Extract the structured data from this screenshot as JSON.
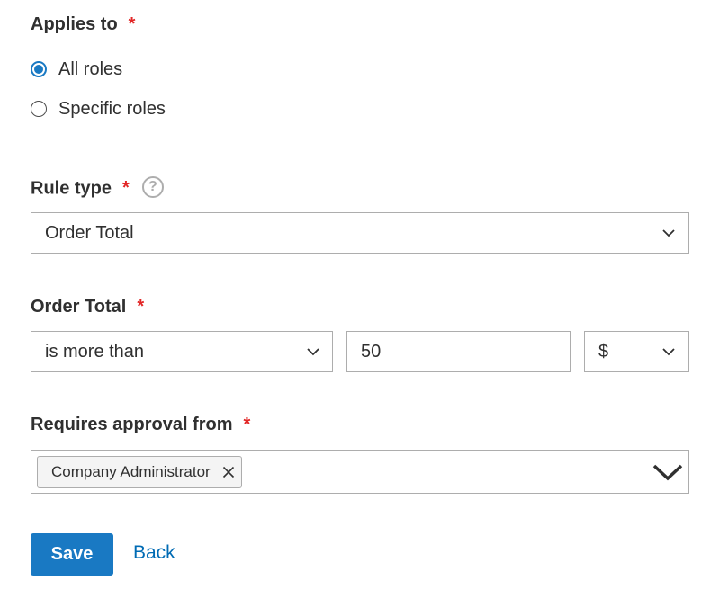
{
  "applies_to": {
    "label": "Applies to",
    "required_mark": "*",
    "options": [
      {
        "label": "All roles",
        "checked": true
      },
      {
        "label": "Specific roles",
        "checked": false
      }
    ]
  },
  "rule_type": {
    "label": "Rule type",
    "required_mark": "*",
    "help_icon": "question-circle-icon",
    "help_glyph": "?",
    "selected": "Order Total"
  },
  "order_total": {
    "label": "Order Total",
    "required_mark": "*",
    "condition": "is more than",
    "amount": "50",
    "currency": "$"
  },
  "approval": {
    "label": "Requires approval from",
    "required_mark": "*",
    "tags": [
      "Company Administrator"
    ]
  },
  "actions": {
    "save_label": "Save",
    "back_label": "Back"
  },
  "colors": {
    "primary": "#1979c3",
    "link": "#006bb4",
    "required": "#e22626",
    "border": "#adadad"
  }
}
